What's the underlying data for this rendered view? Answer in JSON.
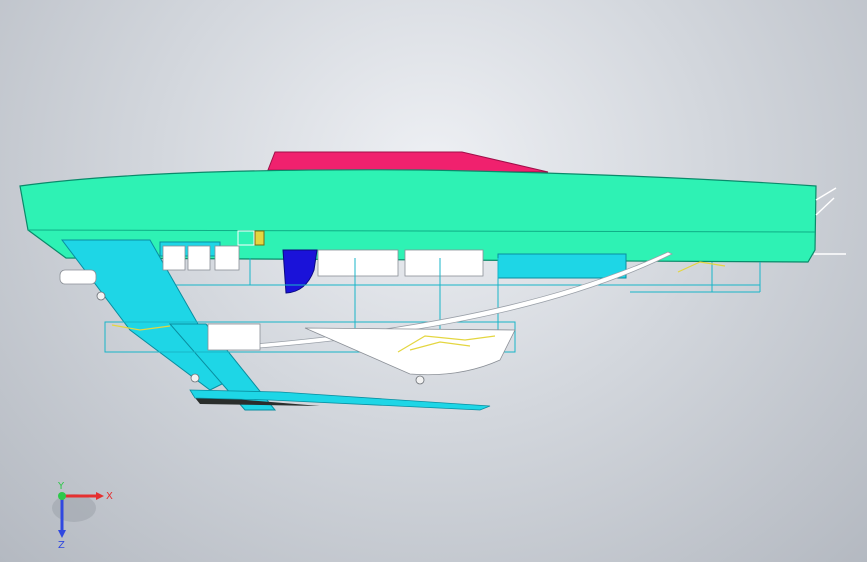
{
  "viewport": {
    "model": "boat-assembly",
    "colors": {
      "hull": "#2ef2b4",
      "hull_edge": "#0fae86",
      "deck": "#f0216e",
      "frame": "#1ed6e6",
      "rudder": "#1a12d9",
      "parts": "#ffffff",
      "hinge": "#e4d640"
    }
  },
  "triad": {
    "x_label": "X",
    "y_label": "Y",
    "z_label": "Z",
    "x_color": "#e53030",
    "y_color": "#2ec84a",
    "z_color": "#3048e0"
  }
}
